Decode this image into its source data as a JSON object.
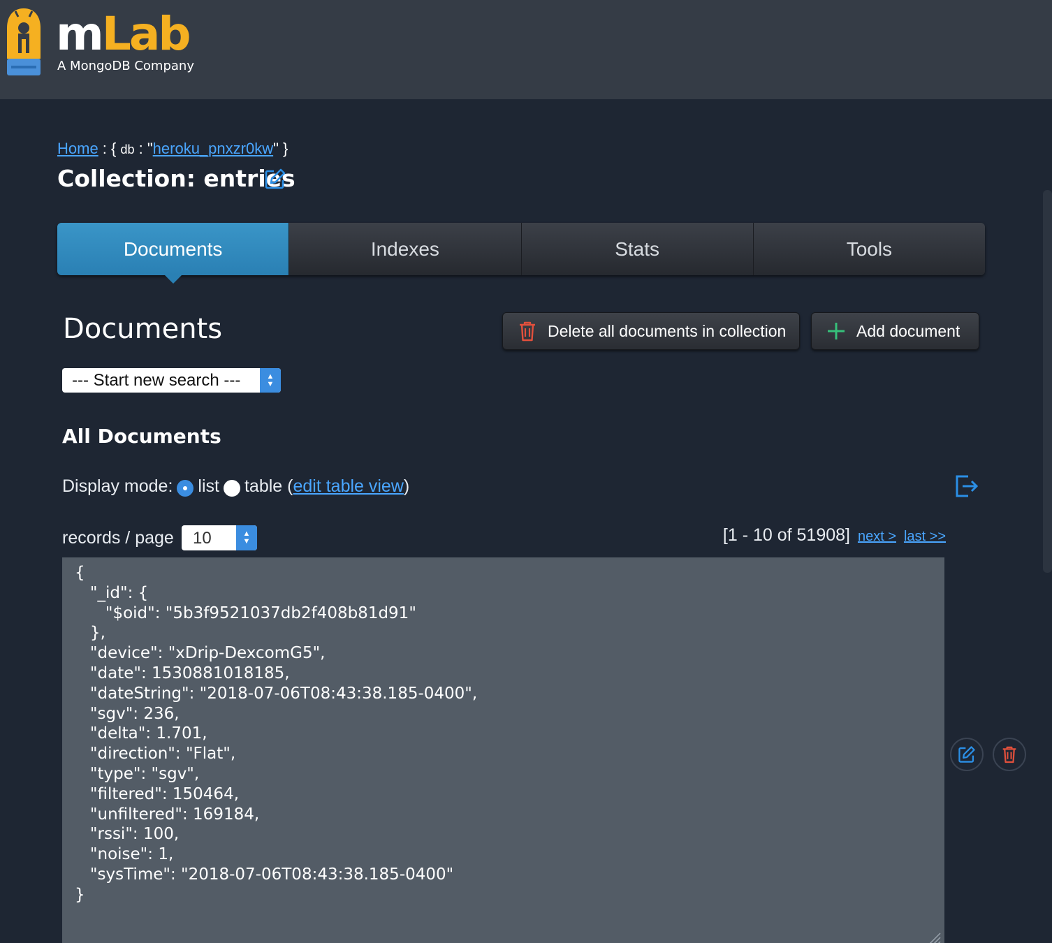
{
  "brand": {
    "logo_m": "m",
    "logo_lab": "Lab",
    "tagline": "A MongoDB Company",
    "colors": {
      "accent": "#f5b021",
      "link": "#4aa6ff",
      "tab_active": "#2a80b4",
      "header_bg": "#353c46",
      "page_bg": "#1e2633"
    }
  },
  "breadcrumb": {
    "home": "Home",
    "sep1": " : { ",
    "db_key": "db",
    "sep2": " : \"",
    "db_name": "heroku_pnxzr0kw",
    "sep3": "\" }"
  },
  "collection": {
    "title": "Collection: entries",
    "edit_icon": "pencil-square-icon"
  },
  "tabs": [
    {
      "label": "Documents",
      "active": true
    },
    {
      "label": "Indexes",
      "active": false
    },
    {
      "label": "Stats",
      "active": false
    },
    {
      "label": "Tools",
      "active": false
    }
  ],
  "documents": {
    "title": "Documents",
    "delete_all_label": "Delete all documents in collection",
    "add_document_label": "Add document",
    "search_select_value": "--- Start new search ---",
    "all_documents_label": "All Documents",
    "display_mode_label": "Display mode:",
    "display_mode_list": "list",
    "display_mode_table": "table",
    "display_mode_selected": "list",
    "edit_table_view": "edit table view",
    "records_per_page_label": "records / page",
    "records_per_page_value": "10",
    "pager_range": "[1 - 10 of 51908]",
    "next_label": "next >",
    "last_label": "last >>"
  },
  "document_lines": [
    "{",
    "   \"_id\": {",
    "      \"$oid\": \"5b3f9521037db2f408b81d91\"",
    "   },",
    "   \"device\": \"xDrip-DexcomG5\",",
    "   \"date\": 1530881018185,",
    "   \"dateString\": \"2018-07-06T08:43:38.185-0400\",",
    "   \"sgv\": 236,",
    "   \"delta\": 1.701,",
    "   \"direction\": \"Flat\",",
    "   \"type\": \"sgv\",",
    "   \"filtered\": 150464,",
    "   \"unfiltered\": 169184,",
    "   \"rssi\": 100,",
    "   \"noise\": 1,",
    "   \"sysTime\": \"2018-07-06T08:43:38.185-0400\"",
    "}"
  ]
}
